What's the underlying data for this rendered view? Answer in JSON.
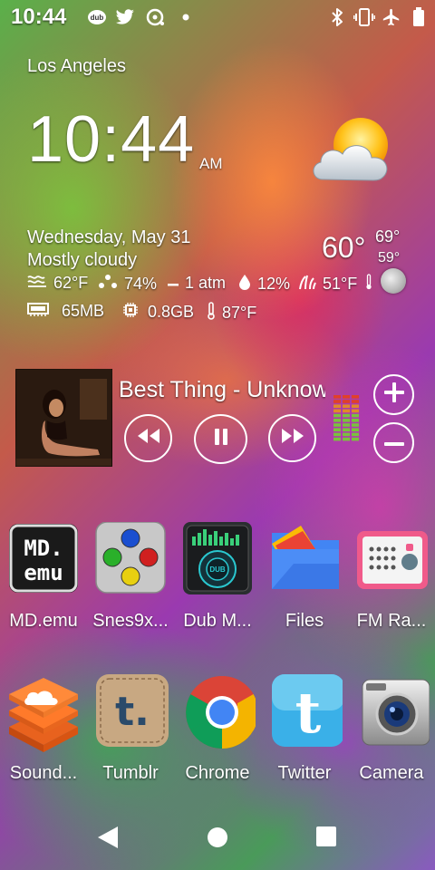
{
  "status_bar": {
    "time": "10:44",
    "left_icons": [
      "dub-icon",
      "twitter-icon",
      "media-icon",
      "dot-icon"
    ],
    "right_icons": [
      "bluetooth-icon",
      "vibrate-icon",
      "airplane-icon",
      "battery-icon"
    ]
  },
  "clock_widget": {
    "city": "Los Angeles",
    "time": "10:44",
    "ampm": "AM",
    "weather_icon": "partly-cloudy-icon",
    "date": "Wednesday, May 31",
    "condition": "Mostly cloudy",
    "temp_now": "60°",
    "temp_high": "69°",
    "temp_low": "59°",
    "stats_row1": {
      "feels_like": "62°F",
      "humidity": "74%",
      "pressure": "1 atm",
      "precipitation": "12%",
      "dew_point": "51°F"
    },
    "stats_row2": {
      "ram": "65MB",
      "storage": "0.8GB",
      "battery_temp": "87°F"
    },
    "moon_icon": "moon-phase-icon"
  },
  "music_widget": {
    "track_title": "Best Thing - Unknown",
    "buttons": [
      "rewind",
      "pause",
      "fast-forward",
      "volume-up",
      "volume-down"
    ]
  },
  "apps_row1": [
    {
      "label": "MD.emu",
      "icon": "md-emu-icon"
    },
    {
      "label": "Snes9x...",
      "icon": "snes9x-icon"
    },
    {
      "label": "Dub M...",
      "icon": "dub-music-icon"
    },
    {
      "label": "Files",
      "icon": "files-icon"
    },
    {
      "label": "FM Ra...",
      "icon": "fm-radio-icon"
    }
  ],
  "apps_row2": [
    {
      "label": "Sound...",
      "icon": "soundcloud-icon"
    },
    {
      "label": "Tumblr",
      "icon": "tumblr-icon"
    },
    {
      "label": "Chrome",
      "icon": "chrome-icon"
    },
    {
      "label": "Twitter",
      "icon": "twitter-icon"
    },
    {
      "label": "Camera",
      "icon": "camera-icon"
    }
  ],
  "nav_bar": [
    "back",
    "home",
    "recents"
  ],
  "colors": {
    "eq_green": "#7ac23c",
    "eq_orange": "#e08a2a",
    "eq_red": "#e0402a"
  }
}
